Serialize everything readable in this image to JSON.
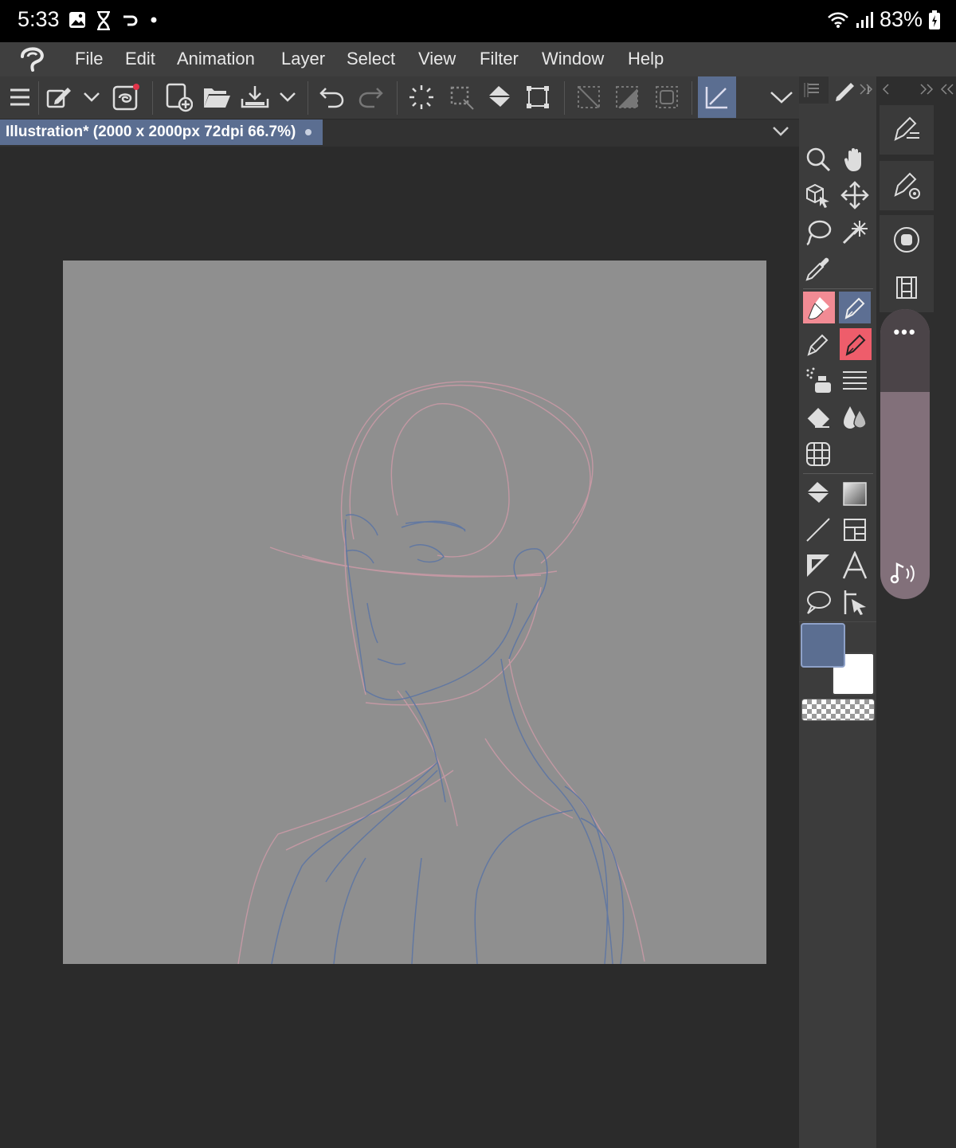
{
  "status_bar": {
    "time": "5:33",
    "battery": "83%"
  },
  "menu": {
    "items": [
      "File",
      "Edit",
      "Animation",
      "Layer",
      "Select",
      "View",
      "Filter",
      "Window",
      "Help"
    ]
  },
  "toolbar": {
    "icons": [
      "menu-icon",
      "edit-dropdown-icon",
      "chevron-down-icon",
      "companion-icon",
      "new-file-icon",
      "open-folder-icon",
      "save-icon",
      "chevron-down-icon",
      "undo-icon",
      "redo-icon",
      "select-all-icon",
      "deselect-icon",
      "fill-icon",
      "transform-icon",
      "clear-icon",
      "fill-selection-icon",
      "selection-border-icon",
      "snap-icon",
      "chevron-down-icon"
    ]
  },
  "document_tab": {
    "title": "Illustration* (2000 x 2000px 72dpi 66.7%)"
  },
  "tool_palette": {
    "tools": [
      "zoom-icon",
      "hand-icon",
      "object-icon",
      "move-icon",
      "lasso-icon",
      "magic-wand-icon",
      "eyedropper-icon",
      "brush-icon",
      "pen-icon",
      "pencil-icon",
      "pen-red-icon",
      "airbrush-icon",
      "hatch-icon",
      "eraser-icon",
      "blend-icon",
      "mesh-icon",
      "fill-icon",
      "gradient-icon",
      "line-icon",
      "frame-icon",
      "ruler-icon",
      "text-icon",
      "balloon-icon",
      "correct-line-icon"
    ]
  },
  "colors": {
    "main": "#5b6e91",
    "sub": "#ffffff",
    "canvas": "#8f8f8f",
    "tab": "#5b6e91",
    "selected_tool": "#f28b94"
  },
  "float_bar": {
    "more": "•••"
  }
}
